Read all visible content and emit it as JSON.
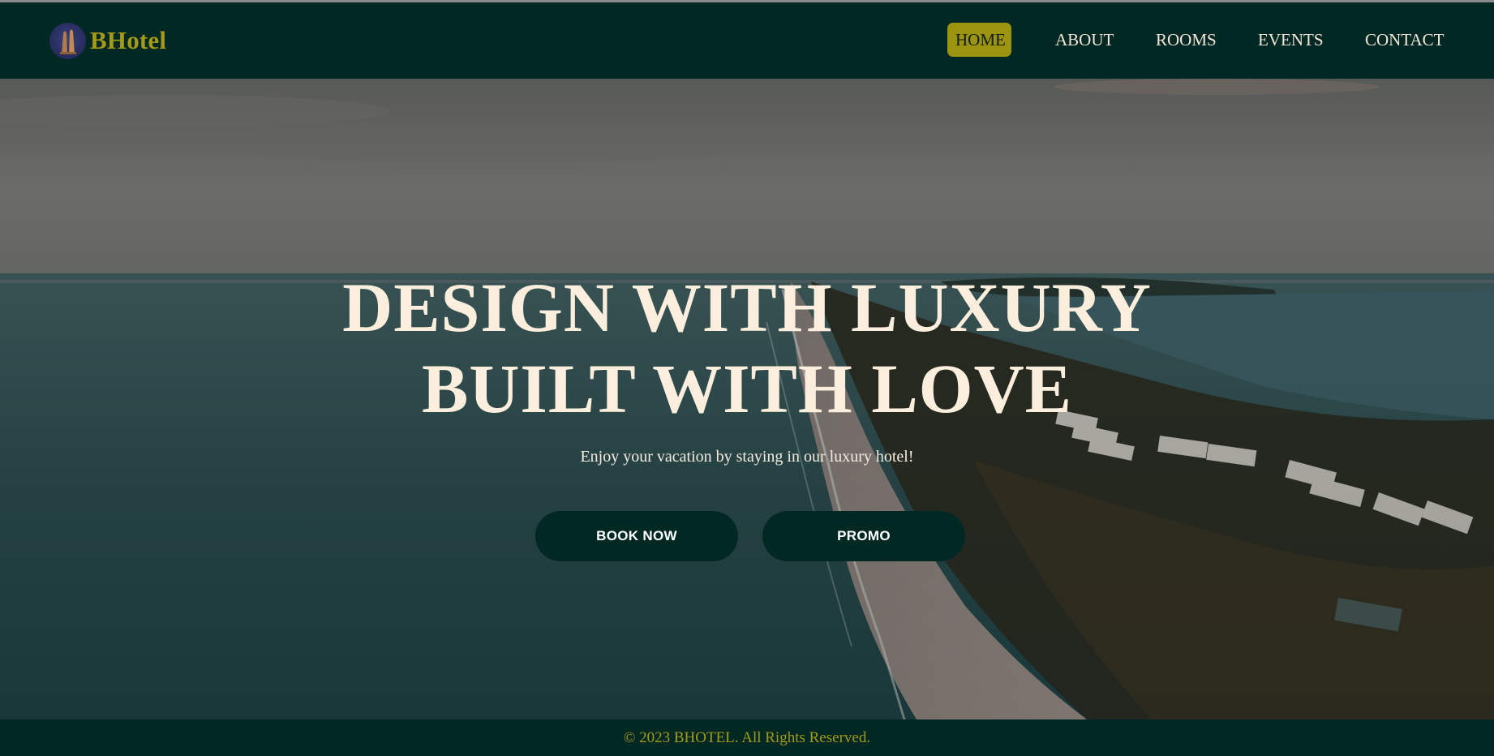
{
  "brand": {
    "name": "BHotel",
    "logo_icon": "hotel-towers-logo",
    "color": "#a39a19"
  },
  "nav": {
    "items": [
      {
        "label": "HOME",
        "active": true
      },
      {
        "label": "ABOUT",
        "active": false
      },
      {
        "label": "ROOMS",
        "active": false
      },
      {
        "label": "EVENTS",
        "active": false
      },
      {
        "label": "CONTACT",
        "active": false
      }
    ]
  },
  "hero": {
    "headline_line1": "DESIGN WITH LUXURY",
    "headline_line2": "BUILT WITH LOVE",
    "subtitle": "Enjoy your vacation by staying in our luxury hotel!",
    "book_button": "BOOK NOW",
    "promo_button": "PROMO"
  },
  "footer": {
    "text": "© 2023 BHOTEL. All Rights Reserved."
  },
  "colors": {
    "dark_green": "#022824",
    "accent_gold": "#9c930f",
    "cream_text": "#fbeedc"
  }
}
